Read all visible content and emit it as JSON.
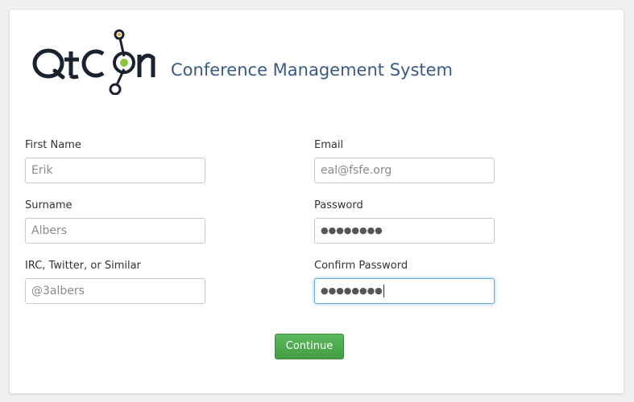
{
  "header": {
    "logo_text": "QtCon",
    "app_title": "Conference Management System"
  },
  "form": {
    "first_name": {
      "label": "First Name",
      "value": "Erik"
    },
    "surname": {
      "label": "Surname",
      "value": "Albers"
    },
    "irc": {
      "label": "IRC, Twitter, or Similar",
      "value": "@3albers"
    },
    "email": {
      "label": "Email",
      "value": "eal@fsfe.org"
    },
    "password": {
      "label": "Password",
      "value": "●●●●●●●●"
    },
    "confirm_password": {
      "label": "Confirm Password",
      "value": "●●●●●●●●"
    },
    "continue_label": "Continue"
  },
  "colors": {
    "title": "#3a5a85",
    "button": "#5cb85c",
    "focus": "#66afe9"
  }
}
